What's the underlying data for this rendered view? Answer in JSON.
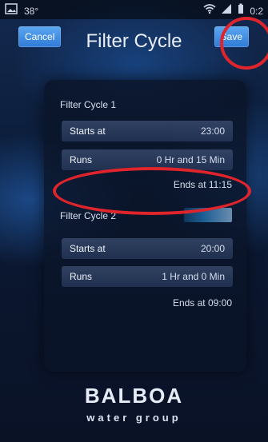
{
  "statusbar": {
    "left_text": "38°",
    "right_text": "0:2"
  },
  "header": {
    "title": "Filter Cycle",
    "cancel_label": "Cancel",
    "save_label": "Save"
  },
  "filter_cycles": [
    {
      "title": "Filter Cycle 1",
      "starts_label": "Starts at",
      "starts_value": "23:00",
      "runs_label": "Runs",
      "runs_value": "0 Hr and 15 Min",
      "ends_text": "Ends at 11:15"
    },
    {
      "title": "Filter Cycle 2",
      "starts_label": "Starts at",
      "starts_value": "20:00",
      "runs_label": "Runs",
      "runs_value": "1 Hr and 0 Min",
      "ends_text": "Ends at 09:00"
    }
  ],
  "brand": {
    "name": "BALBOA",
    "tagline": "water group"
  },
  "colors": {
    "button_blue": "#2f7ad7",
    "highlight_red": "#e0242b",
    "panel_dark": "#0a1428"
  }
}
